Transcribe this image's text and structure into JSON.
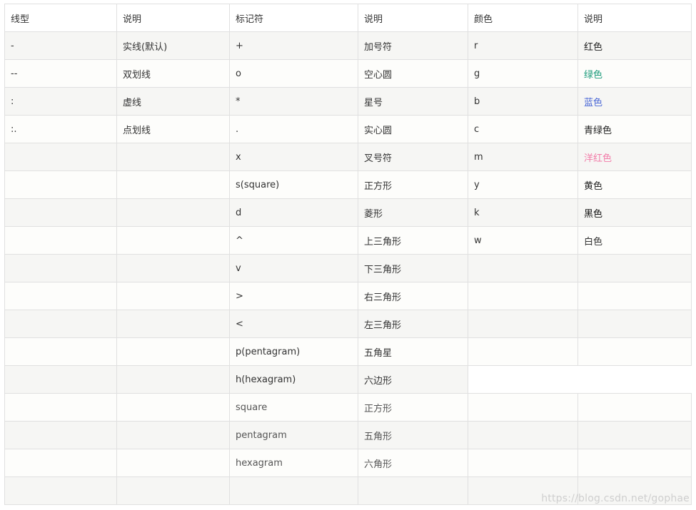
{
  "table": {
    "headers": [
      "线型",
      "说明",
      "标记符",
      "说明",
      "颜色",
      "说明"
    ],
    "rows": [
      [
        "-",
        "实线(默认)",
        "+",
        "加号符",
        "r",
        "红色"
      ],
      [
        "--",
        "双划线",
        "o",
        "空心圆",
        "g",
        "绿色"
      ],
      [
        ":",
        "虚线",
        "*",
        "星号",
        "b",
        "蓝色"
      ],
      [
        ":.",
        "点划线",
        ".",
        "实心圆",
        "c",
        "青绿色"
      ],
      [
        "",
        "",
        "x",
        "叉号符",
        "m",
        "洋红色"
      ],
      [
        "",
        "",
        "s(square)",
        "正方形",
        "y",
        "黄色"
      ],
      [
        "",
        "",
        "d",
        "菱形",
        "k",
        "黑色"
      ],
      [
        "",
        "",
        "^",
        "上三角形",
        "w",
        "白色"
      ],
      [
        "",
        "",
        "v",
        "下三角形",
        "",
        ""
      ],
      [
        "",
        "",
        ">",
        "右三角形",
        "",
        ""
      ],
      [
        "",
        "",
        "<",
        "左三角形",
        "",
        ""
      ],
      [
        "",
        "",
        "p(pentagram)",
        "五角星",
        "",
        ""
      ],
      [
        "",
        "",
        "h(hexagram)",
        "六边形"
      ],
      [
        "",
        "",
        "square",
        "正方形",
        "",
        ""
      ],
      [
        "",
        "",
        "pentagram",
        "五角形",
        "",
        ""
      ],
      [
        "",
        "",
        "hexagram",
        "六角形",
        "",
        ""
      ],
      [
        "",
        "",
        "",
        "",
        "",
        ""
      ]
    ]
  },
  "color_styles": {
    "红色": "#222222",
    "绿色": "#1a9a7a",
    "蓝色": "#4a67d6",
    "青绿色": "#222222",
    "洋红色": "#f27ba8",
    "黄色": "#222222",
    "黑色": "#111111"
  },
  "watermark": "https://blog.csdn.net/gophae"
}
